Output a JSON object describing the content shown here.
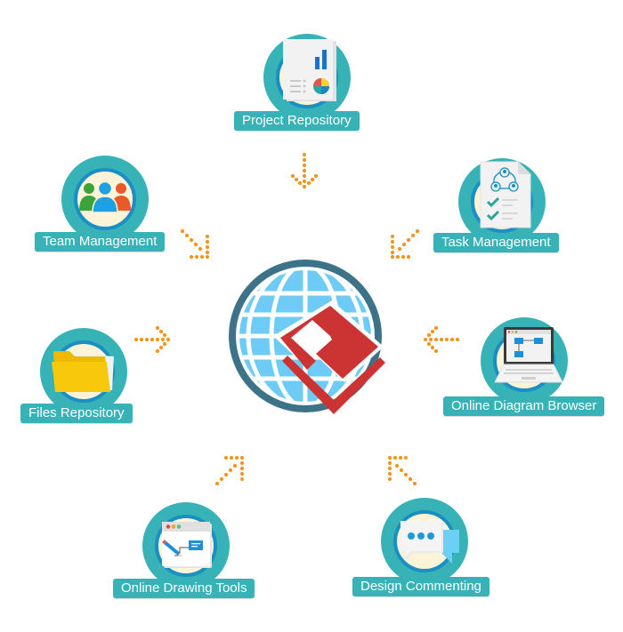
{
  "diagram": {
    "center": {
      "name": "globe-logo",
      "description": "Globe with red diamond logo"
    },
    "nodes": [
      {
        "id": "project-repository",
        "label": "Project Repository",
        "icon": "report-chart-icon"
      },
      {
        "id": "team-management",
        "label": "Team Management",
        "icon": "team-people-icon"
      },
      {
        "id": "task-management",
        "label": "Task Management",
        "icon": "task-checklist-icon"
      },
      {
        "id": "files-repository",
        "label": "Files Repository",
        "icon": "folder-icon"
      },
      {
        "id": "online-diagram-browser",
        "label": "Online Diagram Browser",
        "icon": "laptop-diagram-icon"
      },
      {
        "id": "online-drawing-tools",
        "label": "Online Drawing Tools",
        "icon": "drawing-window-icon"
      },
      {
        "id": "design-commenting",
        "label": "Design Commenting",
        "icon": "chat-bubbles-icon"
      }
    ],
    "edges": [
      {
        "from": "project-repository",
        "to": "center",
        "direction": "down"
      },
      {
        "from": "team-management",
        "to": "center",
        "direction": "down-right"
      },
      {
        "from": "task-management",
        "to": "center",
        "direction": "down-left"
      },
      {
        "from": "files-repository",
        "to": "center",
        "direction": "right"
      },
      {
        "from": "online-diagram-browser",
        "to": "center",
        "direction": "left"
      },
      {
        "from": "online-drawing-tools",
        "to": "center",
        "direction": "up-right"
      },
      {
        "from": "design-commenting",
        "to": "center",
        "direction": "up-left"
      }
    ],
    "colors": {
      "ring": "#37b3b8",
      "inner_ring": "#1a8fc3",
      "inner_fill": "#fdf3d6",
      "arrow": "#f7941d",
      "globe_border": "#3d7388",
      "globe_fill": "#6ecbf5",
      "logo_red": "#cc3333"
    }
  }
}
